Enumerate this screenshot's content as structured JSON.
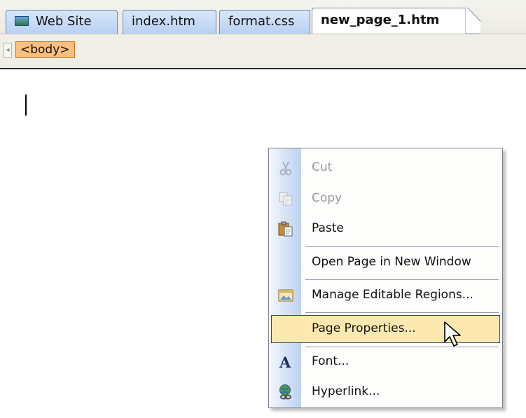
{
  "tabs": [
    {
      "label": "Web Site",
      "icon": "web-site-icon",
      "active": false
    },
    {
      "label": "index.htm",
      "active": false
    },
    {
      "label": "format.css",
      "active": false
    },
    {
      "label": "new_page_1.htm",
      "active": true
    }
  ],
  "tagbar": {
    "scroll_left": "◂",
    "body_tag": "<body>"
  },
  "context_menu": {
    "items": [
      {
        "label": "Cut",
        "icon": "scissors-icon",
        "disabled": true
      },
      {
        "label": "Copy",
        "icon": "copy-icon",
        "disabled": true
      },
      {
        "label": "Paste",
        "icon": "clipboard-icon",
        "disabled": false
      },
      {
        "label": "Open Page in New Window",
        "icon": "",
        "disabled": false
      },
      {
        "label": "Manage Editable Regions...",
        "icon": "editable-regions-icon",
        "disabled": false
      },
      {
        "label": "Page Properties...",
        "icon": "",
        "disabled": false,
        "highlighted": true
      },
      {
        "label": "Font...",
        "icon": "font-icon",
        "disabled": false
      },
      {
        "label": "Hyperlink...",
        "icon": "hyperlink-globe-icon",
        "disabled": false
      }
    ]
  },
  "colors": {
    "highlight": "#fde9b0",
    "highlight_border": "#2c4a7e",
    "tab_blue": "#b9d1f2",
    "body_tag": "#fbc080"
  }
}
